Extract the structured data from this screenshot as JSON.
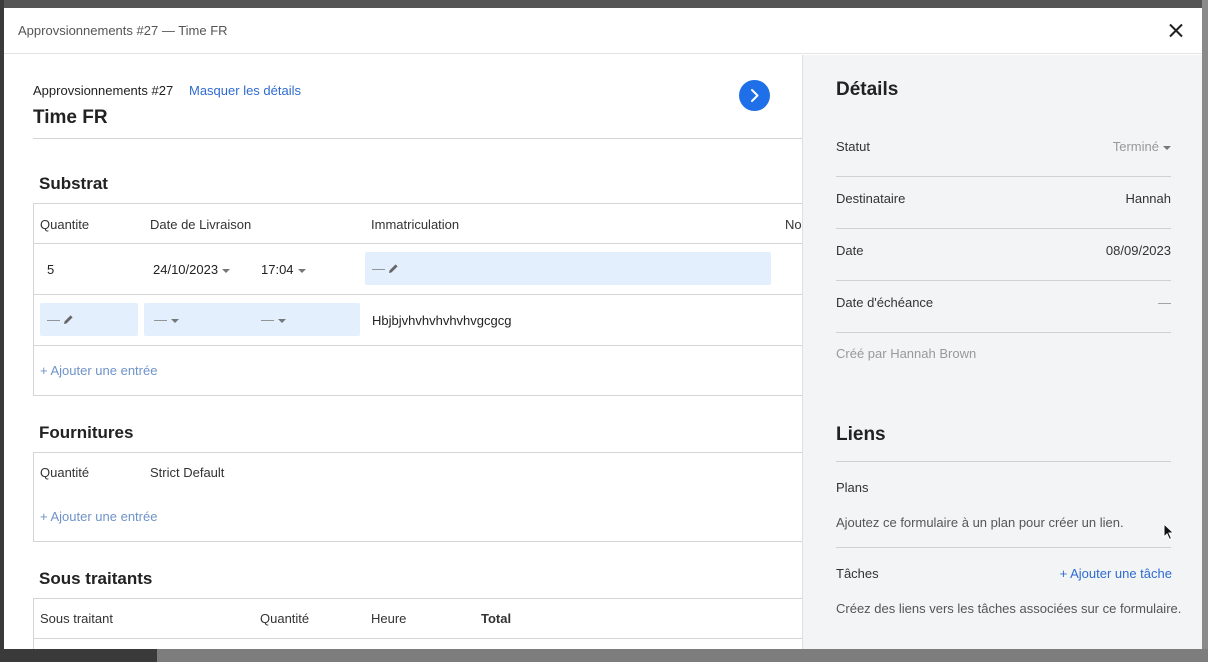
{
  "modal": {
    "title": "Approvsionnements #27 — Time FR"
  },
  "form": {
    "crumb": "Approvsionnements #27",
    "hide_details": "Masquer les détails",
    "title": "Time FR"
  },
  "substrat": {
    "title": "Substrat",
    "headers": [
      "Quantite",
      "Date de Livraison",
      "Immatriculation",
      "No"
    ],
    "row1": {
      "quantite": "5",
      "date": "24/10/2023",
      "heure": "17:04",
      "immatriculation": "—"
    },
    "row2": {
      "quantite": "—",
      "date": "—",
      "heure": "—",
      "immatriculation": "Hbjbjvhvhvhvhvhvgcgcg"
    },
    "add_entry": "+ Ajouter une entrée"
  },
  "fournitures": {
    "title": "Fournitures",
    "headers": [
      "Quantité",
      "Strict Default"
    ],
    "add_entry": "+ Ajouter une entrée"
  },
  "sous_traitants": {
    "title": "Sous traitants",
    "headers": [
      "Sous traitant",
      "Quantité",
      "Heure",
      "Total"
    ]
  },
  "details": {
    "title": "Détails",
    "rows": [
      {
        "label": "Statut",
        "value": "Terminé"
      },
      {
        "label": "Destinataire",
        "value": "Hannah"
      },
      {
        "label": "Date",
        "value": "08/09/2023"
      },
      {
        "label": "Date d'échéance",
        "value": "—"
      }
    ],
    "created_by": "Créé par Hannah Brown"
  },
  "liens": {
    "title": "Liens",
    "plans_label": "Plans",
    "plans_text": "Ajoutez ce formulaire à un plan pour créer un lien.",
    "taches_label": "Tâches",
    "add_task": "+ Ajouter une tâche",
    "taches_text": "Créez des liens vers les tâches associées sur ce formulaire."
  },
  "colors": {
    "accent": "#2f6bd0",
    "next_button": "#1f6fe8",
    "edit_field": "#e3effd",
    "panel_bg": "#f3f4f6"
  }
}
